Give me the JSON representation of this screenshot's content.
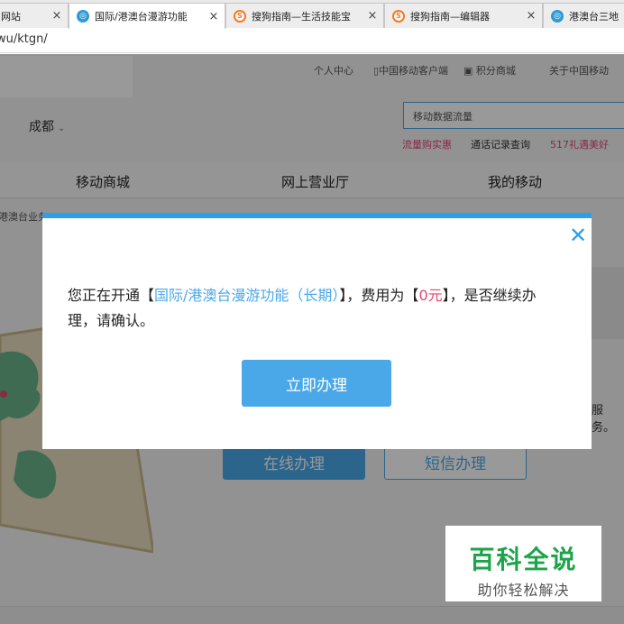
{
  "browser": {
    "tabs": [
      {
        "title": "网站",
        "icon": "globe-icon",
        "active": false
      },
      {
        "title": "国际/港澳台漫游功能",
        "icon": "globe-icon",
        "active": true
      },
      {
        "title": "搜狗指南—生活技能宝",
        "icon": "sogou-icon",
        "active": false
      },
      {
        "title": "搜狗指南—编辑器",
        "icon": "sogou-icon",
        "active": false
      },
      {
        "title": "港澳台三地",
        "icon": "globe-icon",
        "active": false
      }
    ],
    "close_glyph": "×",
    "url": "wu/ktgn/"
  },
  "page": {
    "top_links": [
      "个人中心",
      "中国移动客户端",
      "积分商城",
      "关于中国移动"
    ],
    "city": "成都",
    "search_placeholder": "移动数据流量",
    "quick_links": [
      "流量购实惠",
      "通话记录查询",
      "517礼遇美好"
    ],
    "nav": [
      "移动商城",
      "网上营业厅",
      "我的移动"
    ],
    "breadcrumb": "港澳台业务 >",
    "right_note": "服务。",
    "buttons": {
      "online": "在线办理",
      "sms": "短信办理"
    }
  },
  "dialog": {
    "text_prefix": "您正在开通【",
    "service_name": "国际/港澳台漫游功能（长期）",
    "text_middle": "】，费用为【",
    "fee": "0元",
    "text_suffix": "】，是否继续办理，请确认。",
    "confirm_label": "立即办理",
    "close_glyph": "✕"
  },
  "watermark": {
    "title": "百科全说",
    "subtitle": "助你轻松解决"
  },
  "colors": {
    "accent": "#2d9fe6",
    "button": "#4aa8e8",
    "fee": "#e5466e",
    "quick_link_pink": "#e5466e",
    "watermark_green": "#1ea44a"
  }
}
